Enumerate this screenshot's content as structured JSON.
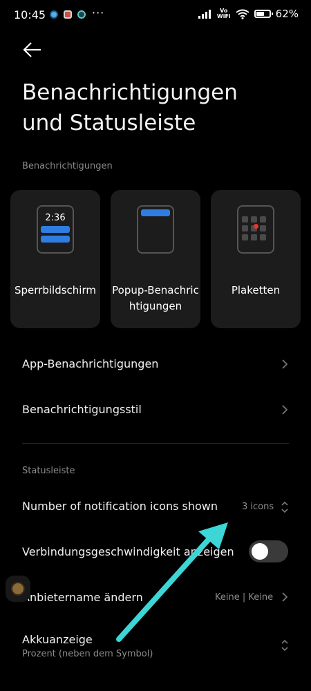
{
  "status_bar": {
    "time": "10:45",
    "more": "···",
    "vowifi_top": "Vo",
    "vowifi_bottom": "WiFi",
    "battery_percent": 62,
    "battery_text": "62%"
  },
  "header": {
    "title": "Benachrichtigungen und Statusleiste"
  },
  "notifications_section": {
    "label": "Benachrichtigungen",
    "cards": [
      {
        "label": "Sperrbildschirm",
        "preview_time": "2:36"
      },
      {
        "label": "Popup-Benachrichtigungen"
      },
      {
        "label": "Plaketten"
      }
    ],
    "rows": [
      {
        "label": "App-Benachrichtigungen"
      },
      {
        "label": "Benachrichtigungsstil"
      }
    ]
  },
  "statusbar_section": {
    "label": "Statusleiste",
    "icons_count": {
      "label": "Number of notification icons shown",
      "value": "3 icons"
    },
    "speed": {
      "label": "Verbindungsgeschwindigkeit anzeigen",
      "enabled": false
    },
    "carrier": {
      "label": "Anbietername ändern",
      "value": "Keine | Keine"
    },
    "battery": {
      "label": "Akkuanzeige",
      "sub": "Prozent (neben dem Symbol)"
    }
  },
  "colors": {
    "accent": "#2f7de1",
    "annotation_arrow": "#3dd6d6"
  }
}
